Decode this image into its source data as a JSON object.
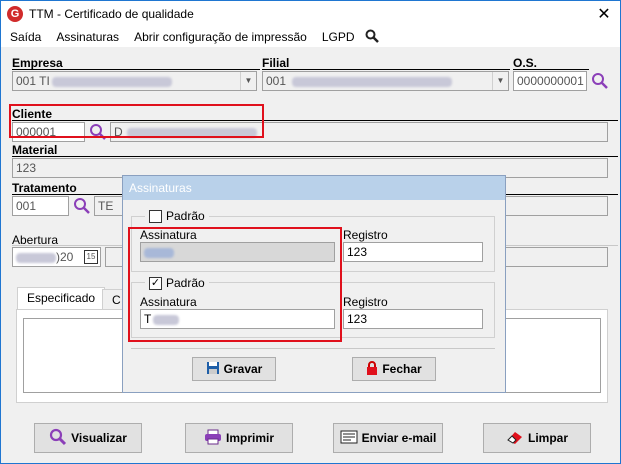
{
  "window": {
    "title": "TTM - Certificado de qualidade",
    "app_icon_letter": "G",
    "close_glyph": "✕"
  },
  "menu": [
    "Saída",
    "Assinaturas",
    "Abrir configuração de impressão",
    "LGPD"
  ],
  "form": {
    "empresa_label": "Empresa",
    "empresa_value": "001 TI",
    "filial_label": "Filial",
    "filial_value": "001",
    "os_label": "O.S.",
    "os_value": "0000000001",
    "cliente_label": "Cliente",
    "cliente_code": "000001",
    "cliente_name_prefix": "D",
    "material_label": "Material",
    "material_value": "123",
    "tratamento_label": "Tratamento",
    "tratamento_code": "001",
    "tratamento_name_prefix": "TE",
    "abertura_label": "Abertura",
    "abertura_date_suffix": ")20",
    "calendar_glyph": "15"
  },
  "tabs": [
    "Especificado",
    "C"
  ],
  "dialog": {
    "title": "Assinaturas",
    "group1": {
      "padrao_label": "Padrão",
      "padrao_checked": false,
      "assinatura_label": "Assinatura",
      "assinatura_value": "",
      "registro_label": "Registro",
      "registro_value": "123"
    },
    "group2": {
      "padrao_label": "Padrão",
      "padrao_checked": true,
      "assinatura_label": "Assinatura",
      "assinatura_value": "T",
      "registro_label": "Registro",
      "registro_value": "123"
    },
    "gravar_label": "Gravar",
    "fechar_label": "Fechar"
  },
  "buttons": {
    "visualizar": "Visualizar",
    "imprimir": "Imprimir",
    "enviar_email": "Enviar e-mail",
    "limpar": "Limpar"
  },
  "colors": {
    "highlight_red": "#e0101c",
    "search_purple": "#8b3fb8",
    "dialog_title_bg": "#b9d1ea"
  }
}
